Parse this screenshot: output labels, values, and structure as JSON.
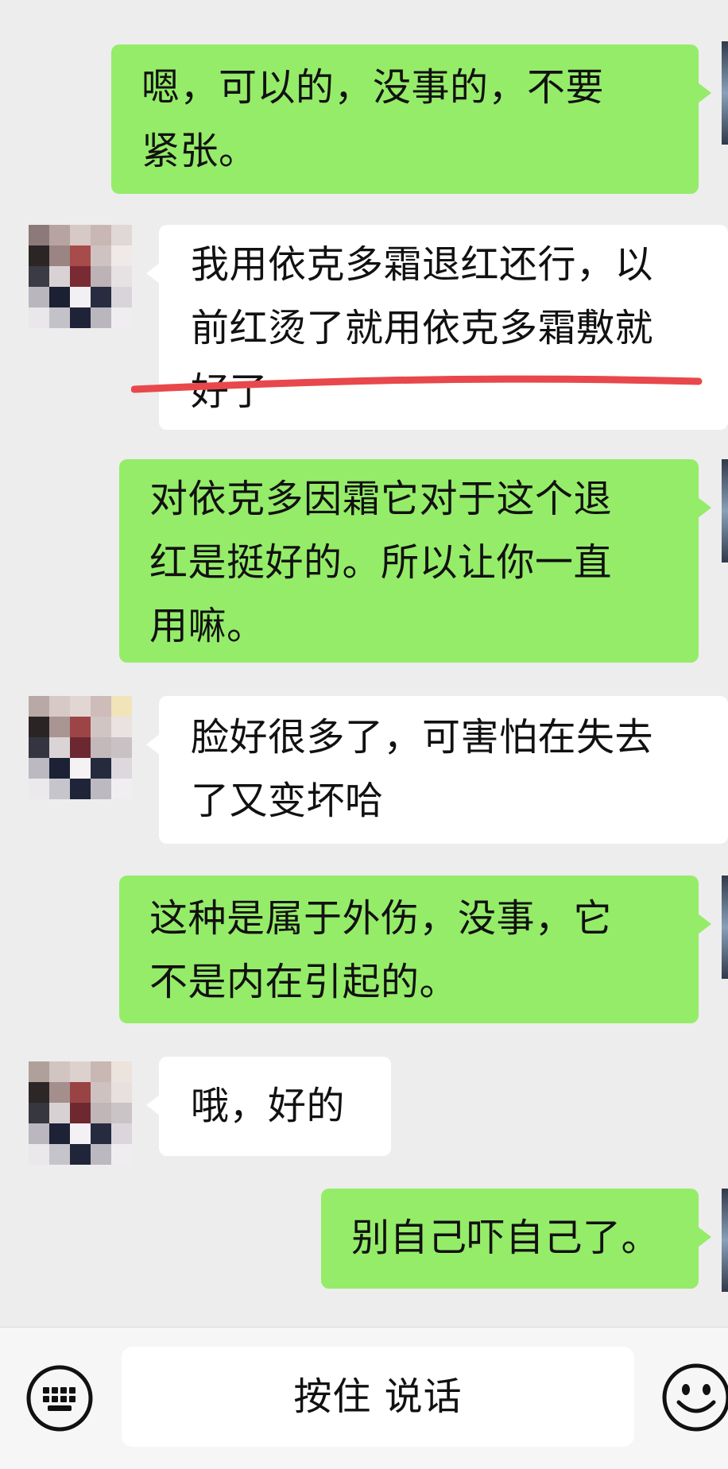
{
  "messages": [
    {
      "side": "out",
      "text": "嗯，可以的，没事的，不要\n紧张。"
    },
    {
      "side": "in",
      "text": "我用依克多霜退红还行，以\n前红烫了就用依克多霜敷就\n好了"
    },
    {
      "side": "out",
      "text": "对依克多因霜它对于这个退\n红是挺好的。所以让你一直\n用嘛。"
    },
    {
      "side": "in",
      "text": "脸好很多了，可害怕在失去\n了又变坏哈"
    },
    {
      "side": "out",
      "text": "这种是属于外伤，没事，它\n不是内在引起的。"
    },
    {
      "side": "in",
      "text": "哦，好的"
    },
    {
      "side": "out",
      "text": "别自己吓自己了。"
    }
  ],
  "input_bar": {
    "voice_label": "按住 说话",
    "left_icon": "keyboard-icon",
    "right_icon": "emoji-icon"
  },
  "colors": {
    "outgoing_bubble": "#95ec69",
    "incoming_bubble": "#ffffff",
    "background": "#ededed",
    "underline": "#e8484b"
  }
}
